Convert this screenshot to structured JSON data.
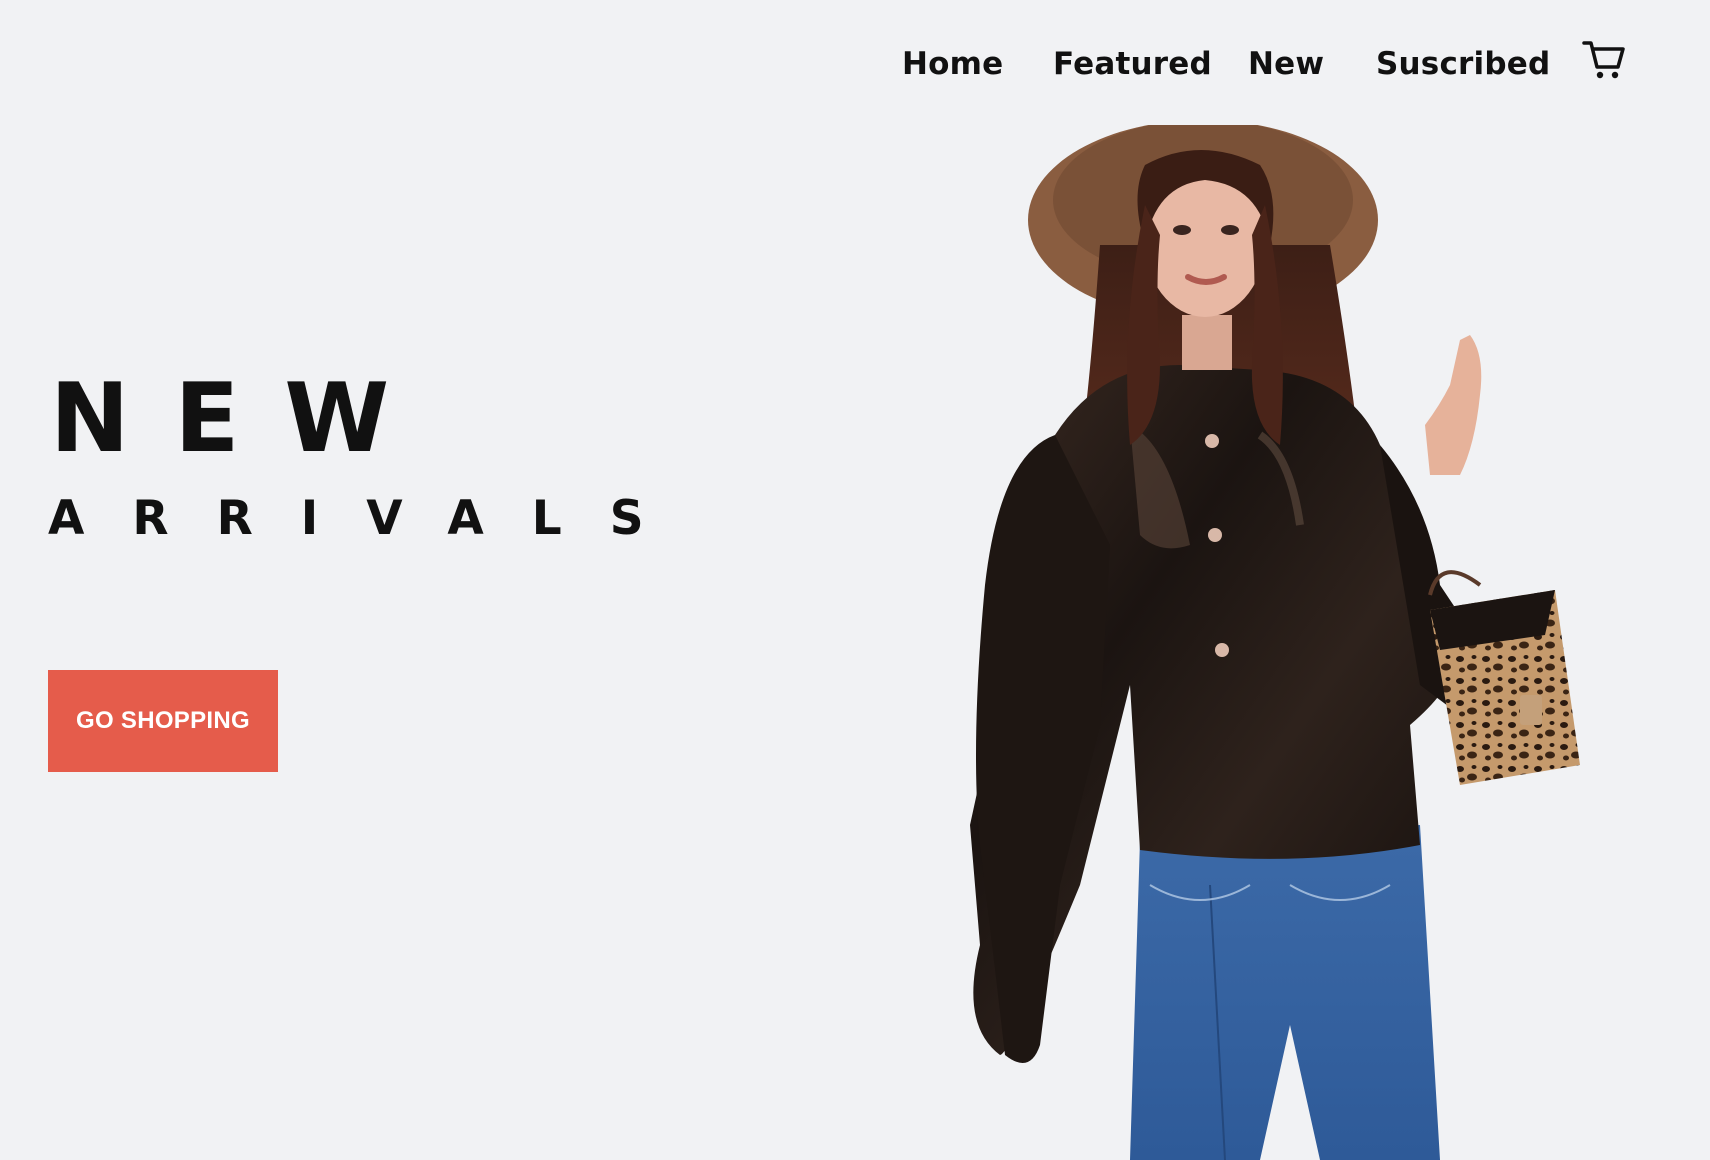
{
  "nav": {
    "items": [
      {
        "label": "Home"
      },
      {
        "label": "Featured"
      },
      {
        "label": "New"
      },
      {
        "label": "Suscribed"
      }
    ],
    "cart_icon": "cart-icon"
  },
  "hero": {
    "headline_line1": "NEW",
    "headline_line2": "ARRIVALS",
    "cta_label": "GO SHOPPING",
    "image": "model-photo"
  },
  "colors": {
    "background": "#f1f2f4",
    "accent": "#e55c4b",
    "text": "#111111"
  }
}
